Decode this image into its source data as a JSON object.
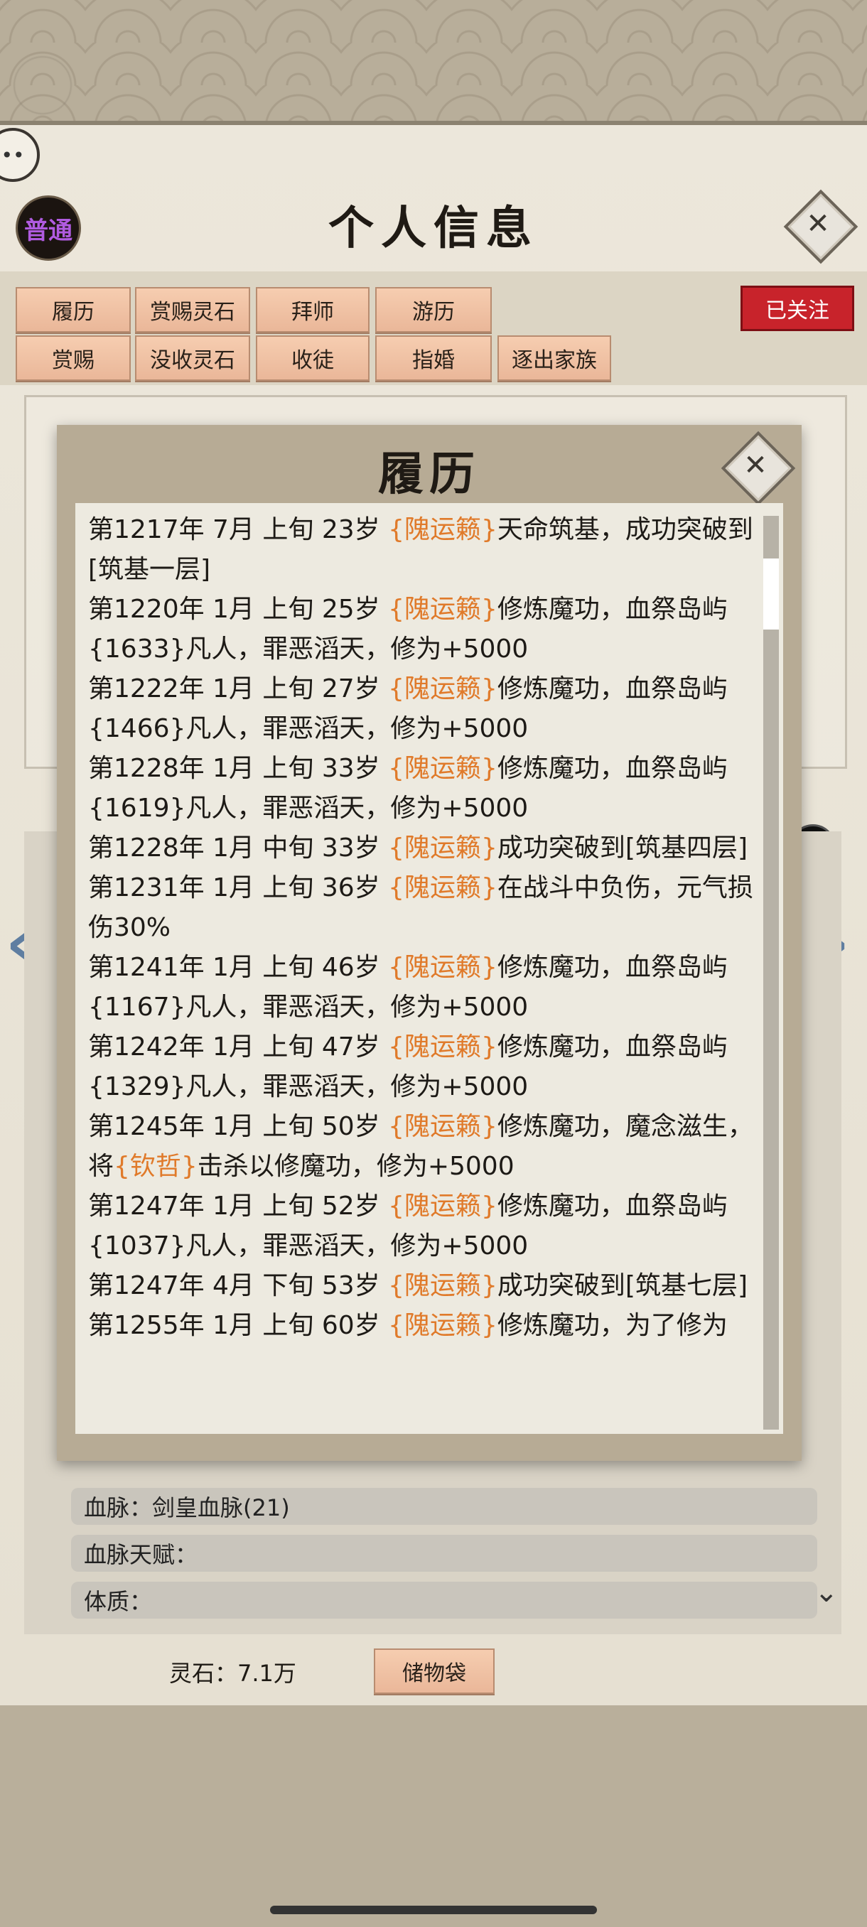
{
  "header": {
    "title": "个人信息",
    "rank_badge": "普通",
    "close_icon": "close-icon"
  },
  "actions": {
    "row1": [
      "履历",
      "赏赐灵石",
      "拜师",
      "游历"
    ],
    "row2": [
      "赏赐",
      "没收灵石",
      "收徒",
      "指婚",
      "逐出家族"
    ],
    "follow": "已关注"
  },
  "attributes": {
    "bloodline": "血脉：剑皇血脉(21)",
    "bloodline_talent": "血脉天赋：",
    "constitution": "体质："
  },
  "footer": {
    "spirit_stones": "灵石：7.1万",
    "storage_bag": "储物袋"
  },
  "modal": {
    "title": "履历",
    "close_icon": "close-icon",
    "entries": [
      {
        "pre": "第1217年 7月 上旬 23岁 ",
        "name": "{隗运籁}",
        "post": "天命筑基，成功突破到[筑基一层]"
      },
      {
        "pre": "第1220年 1月 上旬 25岁 ",
        "name": "{隗运籁}",
        "post": "修炼魔功，血祭岛屿{1633}凡人，罪恶滔天，修为+5000"
      },
      {
        "pre": "第1222年 1月 上旬 27岁 ",
        "name": "{隗运籁}",
        "post": "修炼魔功，血祭岛屿{1466}凡人，罪恶滔天，修为+5000"
      },
      {
        "pre": "第1228年 1月 上旬 33岁 ",
        "name": "{隗运籁}",
        "post": "修炼魔功，血祭岛屿{1619}凡人，罪恶滔天，修为+5000"
      },
      {
        "pre": "第1228年 1月 中旬 33岁 ",
        "name": "{隗运籁}",
        "post": "成功突破到[筑基四层]"
      },
      {
        "pre": "第1231年 1月 上旬 36岁 ",
        "name": "{隗运籁}",
        "post": "在战斗中负伤，元气损伤30%"
      },
      {
        "pre": "第1241年 1月 上旬 46岁 ",
        "name": "{隗运籁}",
        "post": "修炼魔功，血祭岛屿{1167}凡人，罪恶滔天，修为+5000"
      },
      {
        "pre": "第1242年 1月 上旬 47岁 ",
        "name": "{隗运籁}",
        "post": "修炼魔功，血祭岛屿{1329}凡人，罪恶滔天，修为+5000"
      },
      {
        "pre": "第1245年 1月 上旬 50岁 ",
        "name": "{隗运籁}",
        "post": "修炼魔功，魔念滋生，将",
        "name2": "{钦哲}",
        "post2": "击杀以修魔功，修为+5000"
      },
      {
        "pre": "第1247年 1月 上旬 52岁 ",
        "name": "{隗运籁}",
        "post": "修炼魔功，血祭岛屿{1037}凡人，罪恶滔天，修为+5000"
      },
      {
        "pre": "第1247年 4月 下旬 53岁 ",
        "name": "{隗运籁}",
        "post": "成功突破到[筑基七层]"
      },
      {
        "pre": "第1255年 1月 上旬 60岁 ",
        "name": "{隗运籁}",
        "post": "修炼魔功，为了修为"
      }
    ]
  },
  "colors": {
    "highlight": "#e07a2a",
    "follow_bg": "#c8232b",
    "button_bg": "#eab799"
  }
}
